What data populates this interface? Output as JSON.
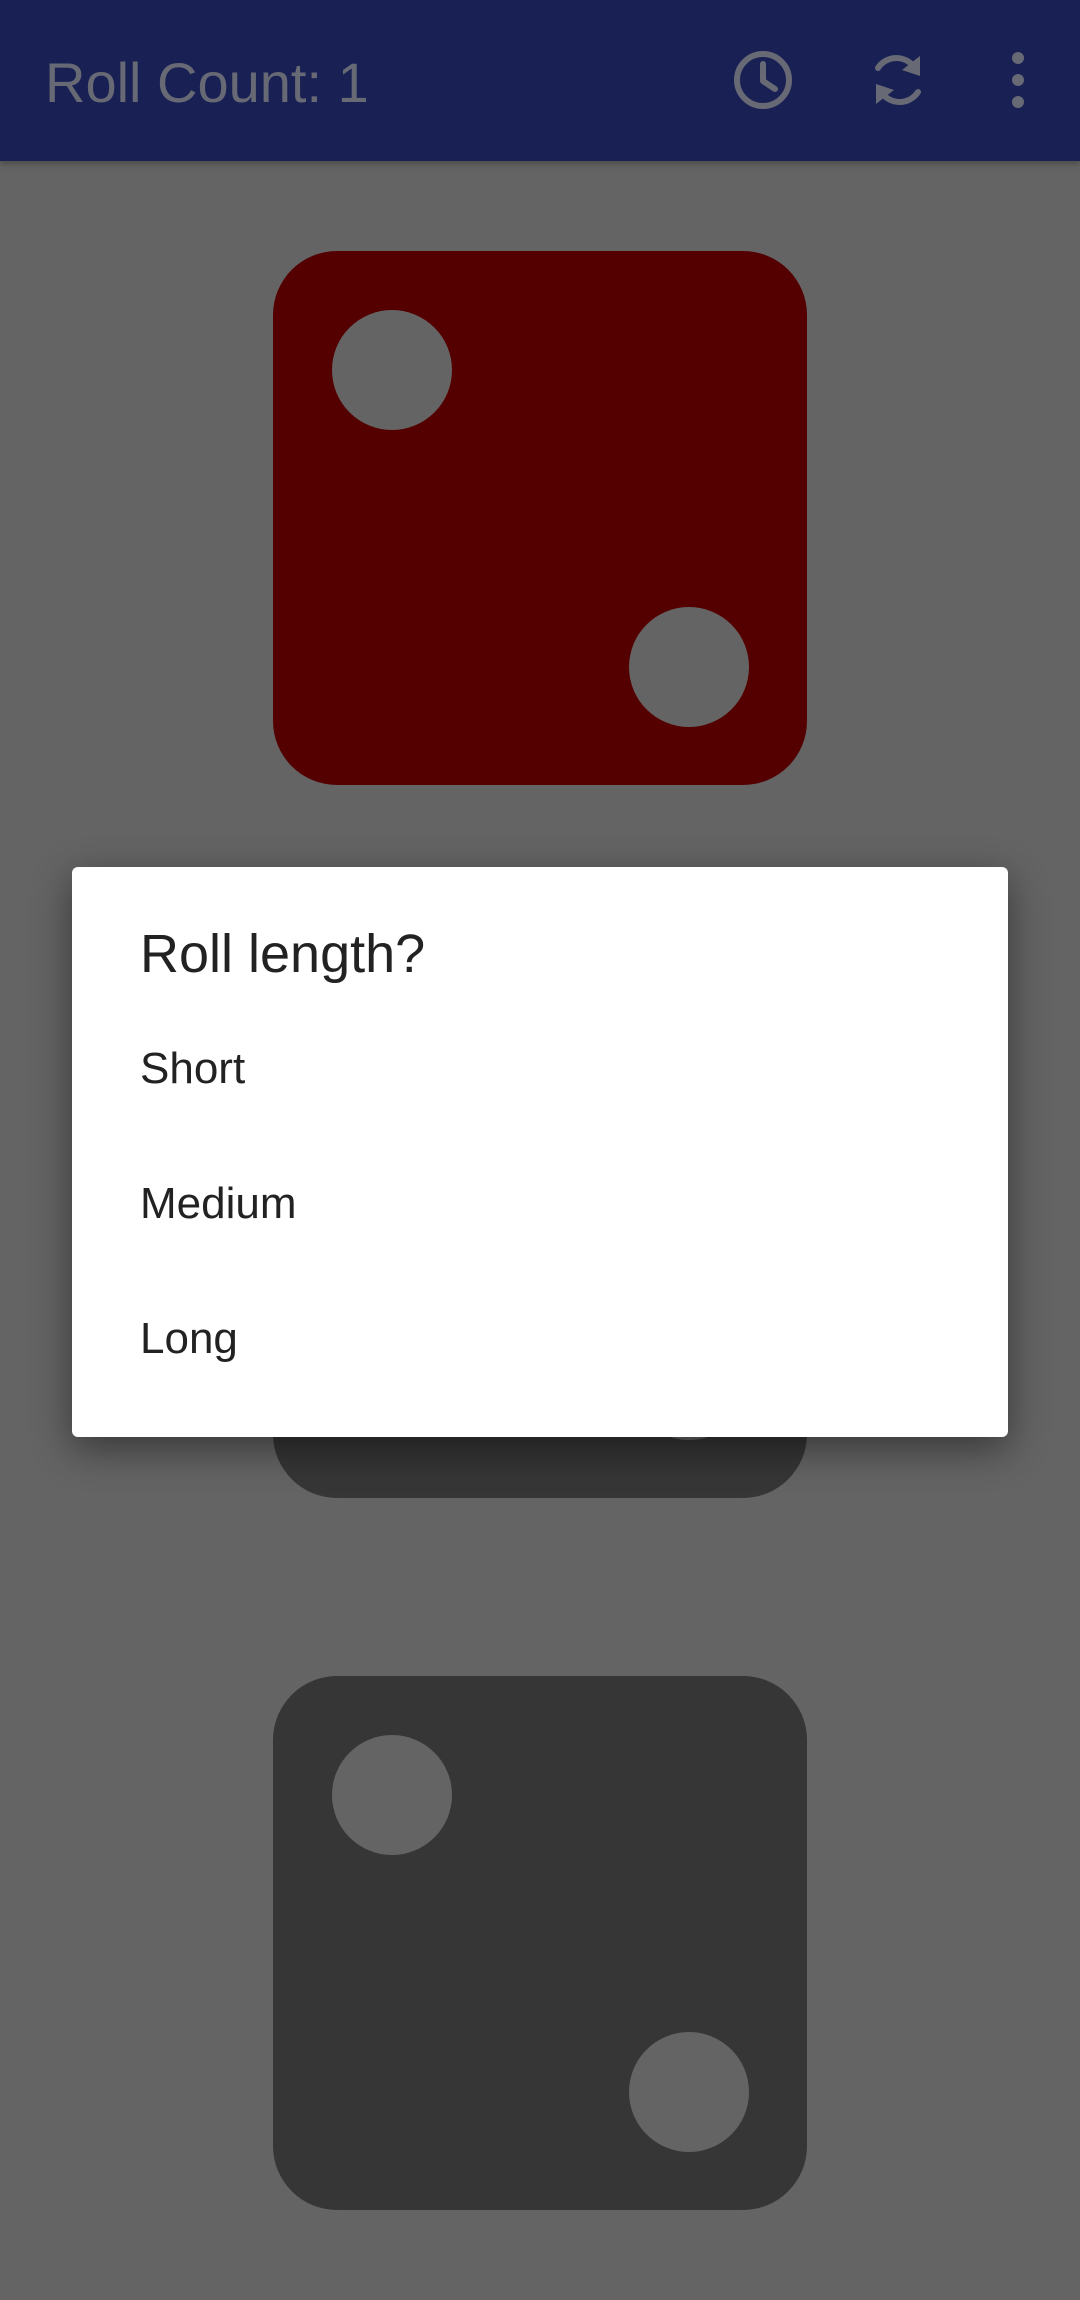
{
  "app_bar": {
    "title": "Roll Count: 1",
    "icons": [
      "history-icon",
      "reroll-icon",
      "more-options-icon"
    ]
  },
  "dice": [
    {
      "value": 2,
      "color": "#a80000",
      "pip_color": "#c8c8c8"
    },
    {
      "value": 2,
      "color": "#6c6c6c",
      "pip_color": "#c8c8c8"
    },
    {
      "value": 2,
      "color": "#6c6c6c",
      "pip_color": "#c8c8c8"
    }
  ],
  "dialog": {
    "title": "Roll length?",
    "options": [
      {
        "label": "Short"
      },
      {
        "label": "Medium"
      },
      {
        "label": "Long"
      }
    ]
  },
  "colors": {
    "app_bar": "#3242a8",
    "background": "#c8c8c8",
    "selected_die": "#a80000",
    "unselected_die": "#6c6c6c",
    "dialog_background": "#ffffff",
    "scrim": "rgba(0,0,0,0.5)"
  }
}
